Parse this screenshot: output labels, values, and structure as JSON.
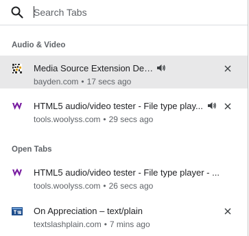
{
  "search": {
    "placeholder": "Search Tabs",
    "icon": "search-icon"
  },
  "colors": {
    "selected_row": "#e8e8e9",
    "section_header": "#5f6368",
    "woolyss_brand": "#7a1fa2"
  },
  "sections": [
    {
      "header": "Audio & Video",
      "tabs": [
        {
          "title": "Media Source Extension Demo",
          "domain": "bayden.com",
          "time": "17 secs ago",
          "favicon": "bayden-favicon",
          "audio": true,
          "selected": true
        },
        {
          "title": "HTML5 audio/video tester - File type play...",
          "domain": "tools.woolyss.com",
          "time": "29 secs ago",
          "favicon": "woolyss-favicon",
          "audio": true,
          "selected": false
        }
      ]
    },
    {
      "header": "Open Tabs",
      "tabs": [
        {
          "title": "HTML5 audio/video tester - File type player - ...",
          "domain": "tools.woolyss.com",
          "time": "26 secs ago",
          "favicon": "woolyss-favicon",
          "audio": false,
          "selected": false
        },
        {
          "title": "On Appreciation – text/plain",
          "domain": "textslashplain.com",
          "time": "7 mins ago",
          "favicon": "textslashplain-favicon",
          "audio": false,
          "selected": false
        }
      ]
    }
  ],
  "meta_separator": "•"
}
